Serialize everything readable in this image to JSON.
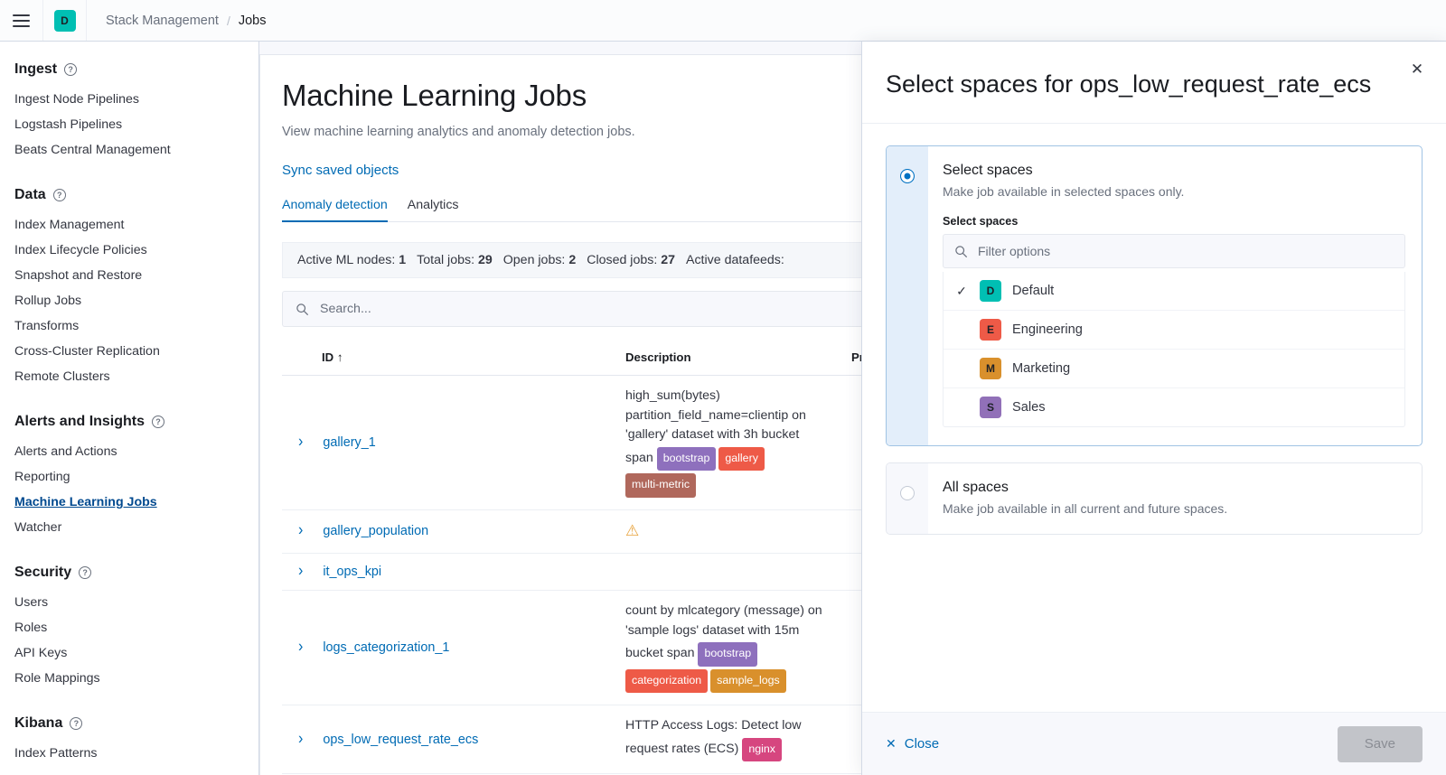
{
  "topbar": {
    "menu_icon": "hamburger-icon",
    "space_avatar": {
      "letter": "D",
      "color": "#00BFB3"
    },
    "breadcrumbs": [
      {
        "label": "Stack Management",
        "current": false
      },
      {
        "label": "Jobs",
        "current": true
      }
    ],
    "separator": "/"
  },
  "sidebar": {
    "groups": [
      {
        "title": "Ingest",
        "items": [
          {
            "label": "Ingest Node Pipelines",
            "active": false
          },
          {
            "label": "Logstash Pipelines",
            "active": false
          },
          {
            "label": "Beats Central Management",
            "active": false
          }
        ]
      },
      {
        "title": "Data",
        "items": [
          {
            "label": "Index Management",
            "active": false
          },
          {
            "label": "Index Lifecycle Policies",
            "active": false
          },
          {
            "label": "Snapshot and Restore",
            "active": false
          },
          {
            "label": "Rollup Jobs",
            "active": false
          },
          {
            "label": "Transforms",
            "active": false
          },
          {
            "label": "Cross-Cluster Replication",
            "active": false
          },
          {
            "label": "Remote Clusters",
            "active": false
          }
        ]
      },
      {
        "title": "Alerts and Insights",
        "items": [
          {
            "label": "Alerts and Actions",
            "active": false
          },
          {
            "label": "Reporting",
            "active": false
          },
          {
            "label": "Machine Learning Jobs",
            "active": true
          },
          {
            "label": "Watcher",
            "active": false
          }
        ]
      },
      {
        "title": "Security",
        "items": [
          {
            "label": "Users",
            "active": false
          },
          {
            "label": "Roles",
            "active": false
          },
          {
            "label": "API Keys",
            "active": false
          },
          {
            "label": "Role Mappings",
            "active": false
          }
        ]
      },
      {
        "title": "Kibana",
        "items": [
          {
            "label": "Index Patterns",
            "active": false
          }
        ]
      }
    ]
  },
  "main": {
    "title": "Machine Learning Jobs",
    "subtitle": "View machine learning analytics and anomaly detection jobs.",
    "sync_link": "Sync saved objects",
    "tabs": [
      {
        "label": "Anomaly detection",
        "active": true
      },
      {
        "label": "Analytics",
        "active": false
      }
    ],
    "stats": [
      {
        "label": "Active ML nodes:",
        "value": "1"
      },
      {
        "label": "Total jobs:",
        "value": "29"
      },
      {
        "label": "Open jobs:",
        "value": "2"
      },
      {
        "label": "Closed jobs:",
        "value": "27"
      },
      {
        "label": "Active datafeeds:",
        "value": ""
      }
    ],
    "search": {
      "placeholder": "Search...",
      "value": ""
    },
    "table": {
      "columns": [
        {
          "label": "ID",
          "sort": "↑"
        },
        {
          "label": "Description"
        },
        {
          "label": "Proc"
        }
      ],
      "rows": [
        {
          "id": "gallery_1",
          "description": "high_sum(bytes) partition_field_name=clientip on 'gallery' dataset with 3h bucket span",
          "warning": false,
          "tags": [
            {
              "label": "bootstrap",
              "color": "#8e70bd"
            },
            {
              "label": "gallery",
              "color": "#ee5a47"
            },
            {
              "label": "multi-metric",
              "color": "#b0685c"
            }
          ]
        },
        {
          "id": "gallery_population",
          "description": "",
          "warning": true,
          "tags": []
        },
        {
          "id": "it_ops_kpi",
          "description": "",
          "warning": false,
          "tags": []
        },
        {
          "id": "logs_categorization_1",
          "description": "count by mlcategory (message) on 'sample logs' dataset with 15m bucket span",
          "warning": false,
          "tags": [
            {
              "label": "bootstrap",
              "color": "#8e70bd"
            },
            {
              "label": "categorization",
              "color": "#ee5a47"
            },
            {
              "label": "sample_logs",
              "color": "#d9902c"
            }
          ]
        },
        {
          "id": "ops_low_request_rate_ecs",
          "description": "HTTP Access Logs: Detect low request rates (ECS)",
          "warning": false,
          "tags": [
            {
              "label": "nginx",
              "color": "#d6467f"
            }
          ]
        }
      ]
    }
  },
  "flyout": {
    "title": "Select spaces for ops_low_request_rate_ecs",
    "close_icon": "close-icon",
    "options": [
      {
        "title": "Select spaces",
        "description": "Make job available in selected spaces only.",
        "selected": true
      },
      {
        "title": "All spaces",
        "description": "Make job available in all current and future spaces.",
        "selected": false
      }
    ],
    "field_label": "Select spaces",
    "filter": {
      "placeholder": "Filter options",
      "value": ""
    },
    "spaces": [
      {
        "name": "Default",
        "letter": "D",
        "color": "#00BFB3",
        "checked": true
      },
      {
        "name": "Engineering",
        "letter": "E",
        "color": "#ee5a47",
        "checked": false
      },
      {
        "name": "Marketing",
        "letter": "M",
        "color": "#d9902c",
        "checked": false
      },
      {
        "name": "Sales",
        "letter": "S",
        "color": "#9170b8",
        "checked": false
      }
    ],
    "check_glyph": "✓",
    "footer": {
      "close_label": "Close",
      "close_x": "✕",
      "save_label": "Save",
      "save_disabled": true
    }
  }
}
